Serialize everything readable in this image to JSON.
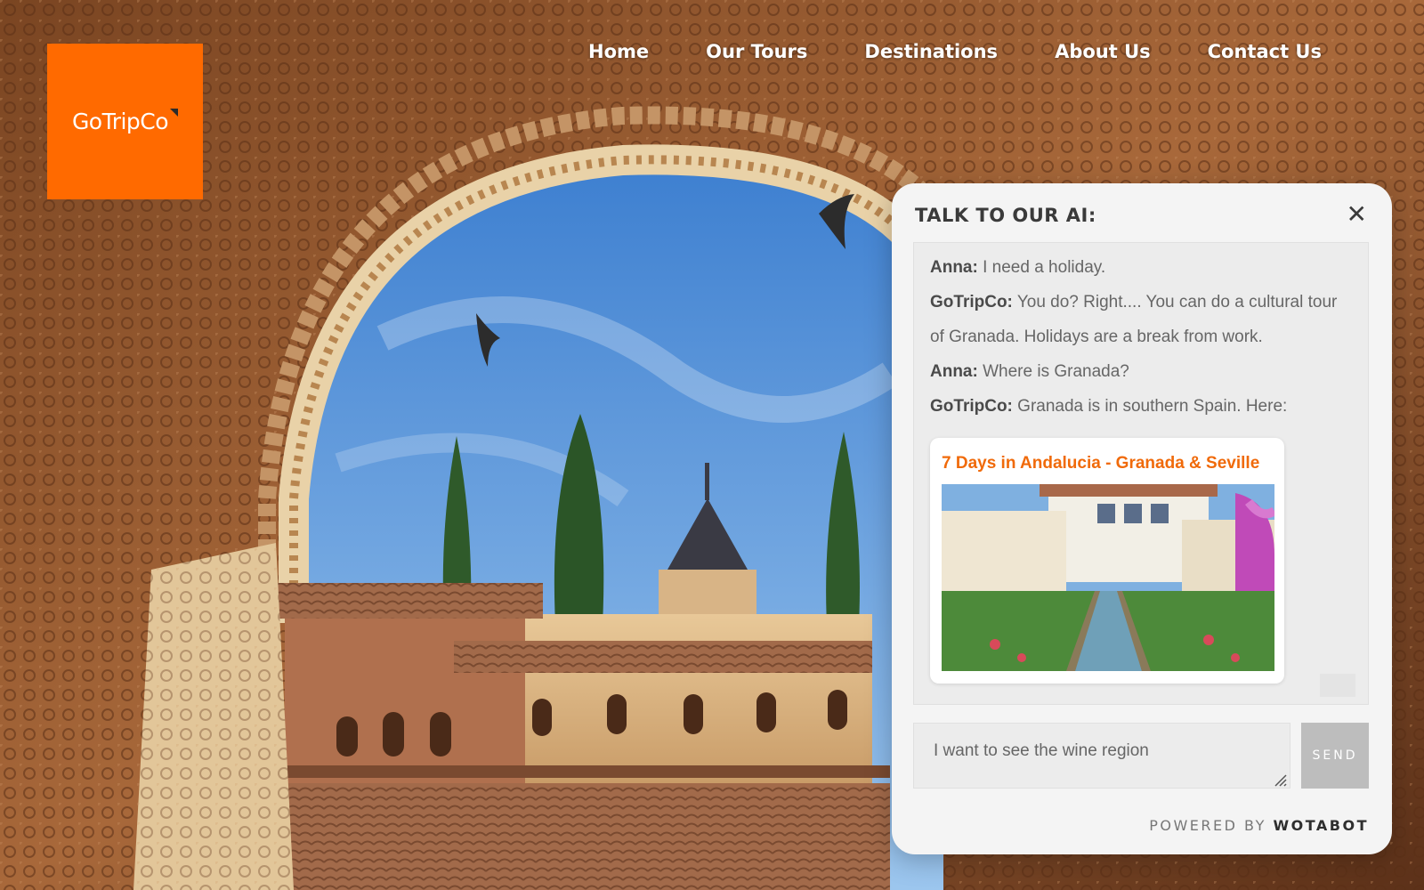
{
  "brand": {
    "name": "GoTripCo",
    "color": "#ff6a00"
  },
  "nav": {
    "items": [
      {
        "label": "Home"
      },
      {
        "label": "Our Tours"
      },
      {
        "label": "Destinations"
      },
      {
        "label": "About Us"
      },
      {
        "label": "Contact Us"
      }
    ]
  },
  "chat": {
    "title": "TALK TO OUR AI:",
    "close_icon": "close-icon",
    "messages": [
      {
        "speaker": "Anna:",
        "text": " I need a holiday."
      },
      {
        "speaker": "GoTripCo:",
        "text": " You do? Right.... You can do a cultural tour of Granada. Holidays are a break from work."
      },
      {
        "speaker": "Anna:",
        "text": " Where is Granada?"
      },
      {
        "speaker": "GoTripCo:",
        "text": " Granada is in southern Spain. Here:"
      }
    ],
    "card": {
      "title": "7 Days in Andalucia - Granada & Seville",
      "title_color": "#f06a0a"
    },
    "input_value": "I want to see the wine region",
    "send_label": "SEND",
    "powered_prefix": "POWERED BY ",
    "powered_brand": "WOTABOT"
  }
}
